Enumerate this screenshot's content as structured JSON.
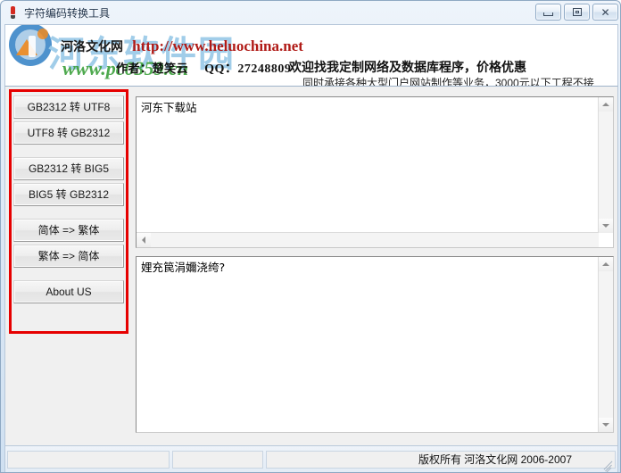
{
  "window": {
    "title": "字符编码转换工具",
    "icon": "bulb-icon",
    "controls": {
      "minimize": "minimize-icon",
      "maximize": "maximize-icon",
      "close": "close-icon"
    }
  },
  "header": {
    "site_name": "河洛文化网",
    "site_url": "http://www.heluochina.net",
    "author": "作者：楚笑云",
    "qq": "QQ：27248809",
    "promo_line1": "欢迎找我定制网络及数据库程序，价格优惠",
    "promo_line2": "同时承接各种大型门户网站制作等业务，3000元以下工程不接",
    "watermarks": {
      "primary": "河东软件园",
      "primary_color": "#9ccbe8",
      "secondary": "www.pc0359.cn",
      "secondary_color": "#3fa23f",
      "logo": "circle-logo-icon"
    }
  },
  "annotation": {
    "highlight_color": "#e60000",
    "target": "conversion-buttons-panel"
  },
  "buttons": [
    {
      "label": "GB2312 转 UTF8",
      "name": "convert-gb2312-to-utf8-button",
      "gap": false
    },
    {
      "label": "UTF8 转 GB2312",
      "name": "convert-utf8-to-gb2312-button",
      "gap": false
    },
    {
      "label": "GB2312 转 BIG5",
      "name": "convert-gb2312-to-big5-button",
      "gap": true
    },
    {
      "label": "BIG5 转 GB2312",
      "name": "convert-big5-to-gb2312-button",
      "gap": false
    },
    {
      "label": "简体 => 繁体",
      "name": "convert-simplified-to-traditional-button",
      "gap": true
    },
    {
      "label": "繁体 => 简体",
      "name": "convert-traditional-to-simplified-button",
      "gap": false
    },
    {
      "label": "About US",
      "name": "about-us-button",
      "gap": true
    }
  ],
  "editors": {
    "source": {
      "value": "河东下载站",
      "scrollbars": [
        "vertical",
        "horizontal"
      ]
    },
    "result": {
      "value": "娌充笢涓嬭浇绔?",
      "scrollbars": [
        "vertical"
      ]
    }
  },
  "status_bar": {
    "cell1": "",
    "cell2": "",
    "cell3": "版权所有  河洛文化网  2006-2007"
  }
}
